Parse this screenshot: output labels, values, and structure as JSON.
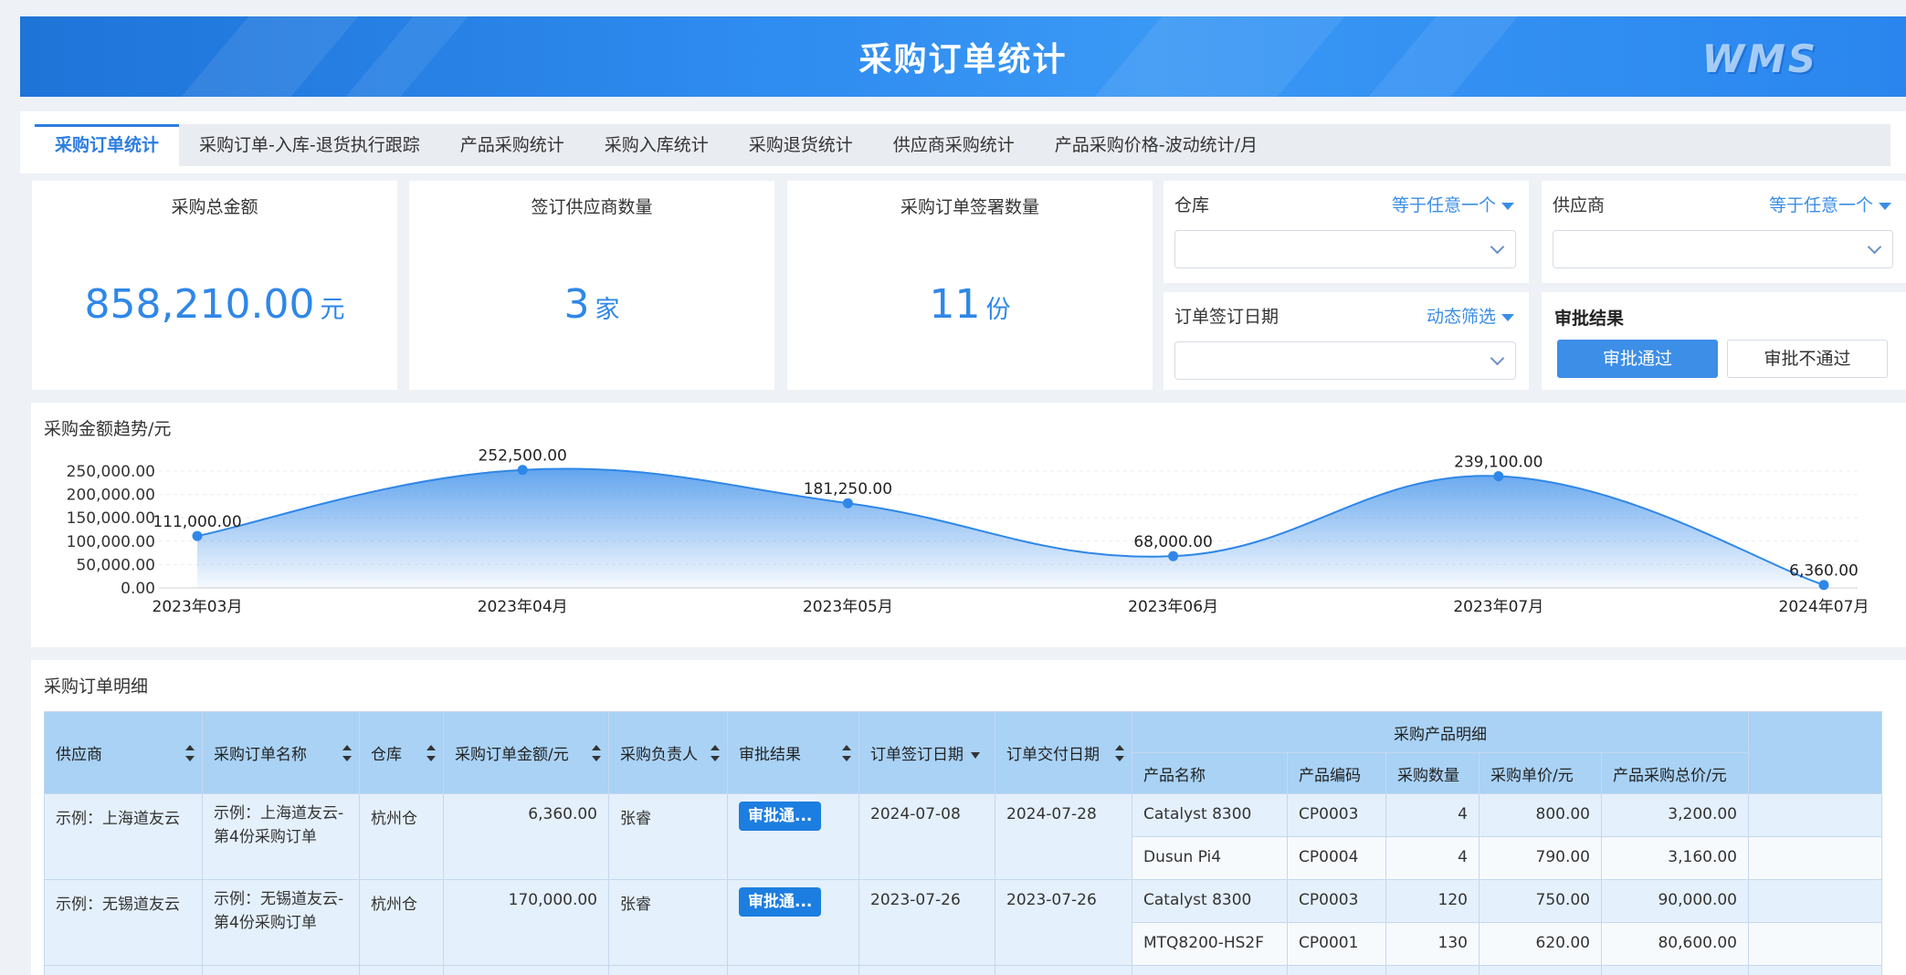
{
  "header": {
    "title": "采购订单统计",
    "logo": "WMS"
  },
  "tabs": [
    {
      "label": "采购订单统计",
      "active": true
    },
    {
      "label": "采购订单-入库-退货执行跟踪"
    },
    {
      "label": "产品采购统计"
    },
    {
      "label": "采购入库统计"
    },
    {
      "label": "采购退货统计"
    },
    {
      "label": "供应商采购统计"
    },
    {
      "label": "产品采购价格-波动统计/月"
    }
  ],
  "stats": [
    {
      "label": "采购总金额",
      "value": "858,210.00",
      "unit": "元"
    },
    {
      "label": "签订供应商数量",
      "value": "3",
      "unit": "家"
    },
    {
      "label": "采购订单签署数量",
      "value": "11",
      "unit": "份"
    }
  ],
  "filters": {
    "warehouse": {
      "label": "仓库",
      "mode": "等于任意一个"
    },
    "supplier": {
      "label": "供应商",
      "mode": "等于任意一个"
    },
    "sign_date": {
      "label": "订单签订日期",
      "mode": "动态筛选"
    },
    "approval": {
      "label": "审批结果",
      "pass": "审批通过",
      "fail": "审批不通过",
      "selected": "审批通过"
    }
  },
  "chart_title": "采购金额趋势/元",
  "chart_data": {
    "type": "area",
    "categories": [
      "2023年03月",
      "2023年04月",
      "2023年05月",
      "2023年06月",
      "2023年07月",
      "2024年07月"
    ],
    "values": [
      111000,
      252500,
      181250,
      68000,
      239100,
      6360
    ],
    "value_labels": [
      "111,000.00",
      "252,500.00",
      "181,250.00",
      "68,000.00",
      "239,100.00",
      "6,360.00"
    ],
    "y_ticks": [
      "0.00",
      "50,000.00",
      "100,000.00",
      "150,000.00",
      "200,000.00",
      "250,000.00"
    ],
    "ylim": [
      0,
      250000
    ],
    "color": "#2f87e8"
  },
  "table": {
    "title": "采购订单明细",
    "headers": {
      "supplier": "供应商",
      "order_name": "采购订单名称",
      "warehouse": "仓库",
      "amount": "采购订单金额/元",
      "owner": "采购负责人",
      "approval": "审批结果",
      "sign_date": "订单签订日期",
      "delivery_date": "订单交付日期",
      "group": "采购产品明细",
      "product_name": "产品名称",
      "product_code": "产品编码",
      "qty": "采购数量",
      "unit_price": "采购单价/元",
      "total_price": "产品采购总价/元"
    },
    "orders": [
      {
        "supplier": "示例：上海道友云",
        "order_name": "示例：上海道友云-第4份采购订单",
        "warehouse": "杭州仓",
        "amount": "6,360.00",
        "owner": "张睿",
        "approval": "审批通...",
        "sign_date": "2024-07-08",
        "delivery_date": "2024-07-28",
        "products": [
          {
            "name": "Catalyst 8300",
            "code": "CP0003",
            "qty": "4",
            "unit_price": "800.00",
            "total": "3,200.00"
          },
          {
            "name": "Dusun Pi4",
            "code": "CP0004",
            "qty": "4",
            "unit_price": "790.00",
            "total": "3,160.00"
          }
        ]
      },
      {
        "supplier": "示例：无锡道友云",
        "order_name": "示例：无锡道友云-第4份采购订单",
        "warehouse": "杭州仓",
        "amount": "170,000.00",
        "owner": "张睿",
        "approval": "审批通...",
        "sign_date": "2023-07-26",
        "delivery_date": "2023-07-26",
        "products": [
          {
            "name": "Catalyst 8300",
            "code": "CP0003",
            "qty": "120",
            "unit_price": "750.00",
            "total": "90,000.00"
          },
          {
            "name": "MTQ8200-HS2F",
            "code": "CP0001",
            "qty": "130",
            "unit_price": "620.00",
            "total": "80,600.00"
          }
        ]
      }
    ]
  }
}
